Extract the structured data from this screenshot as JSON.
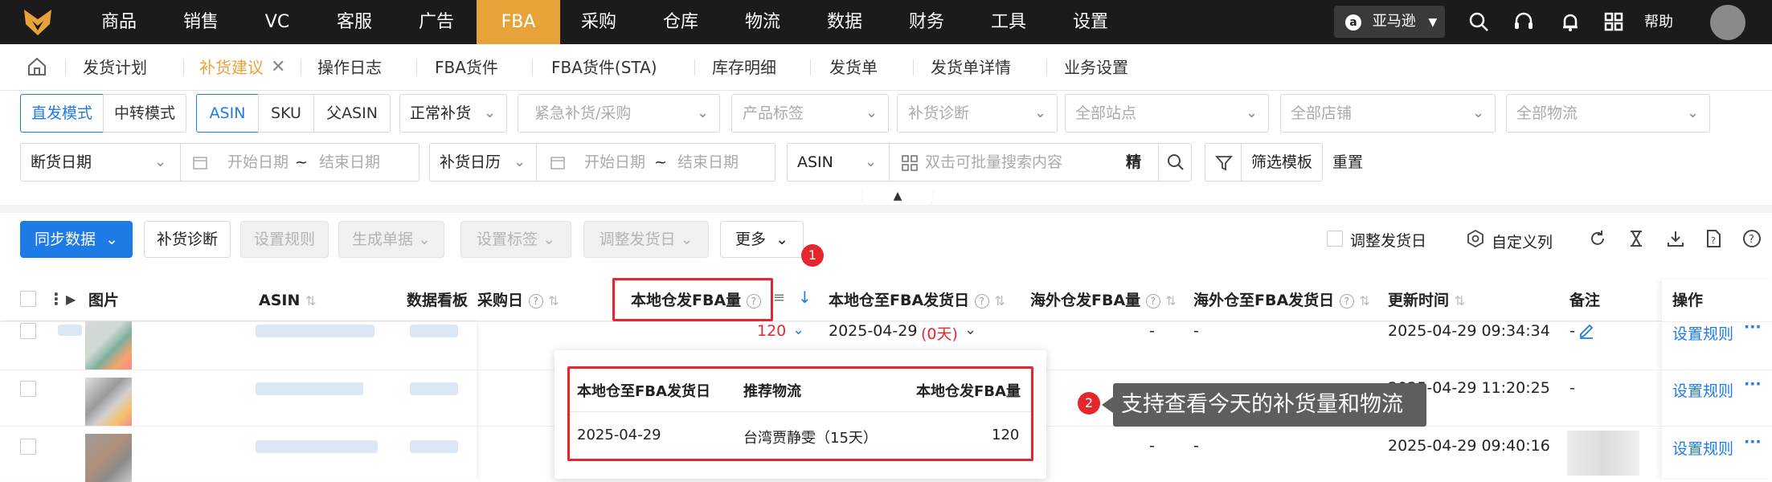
{
  "topnav": {
    "items": [
      "商品",
      "销售",
      "VC",
      "客服",
      "广告",
      "FBA",
      "采购",
      "仓库",
      "物流",
      "数据",
      "财务",
      "工具",
      "设置"
    ],
    "active": "FBA",
    "marketplace": "亚马逊",
    "help": "帮助"
  },
  "tabs": [
    "发货计划",
    "补货建议",
    "操作日志",
    "FBA货件",
    "FBA货件(STA)",
    "库存明细",
    "发货单",
    "发货单详情",
    "业务设置"
  ],
  "active_tab": "补货建议",
  "filters": {
    "mode": [
      "直发模式",
      "中转模式"
    ],
    "id_type": [
      "ASIN",
      "SKU",
      "父ASIN"
    ],
    "replenish_type": "正常补货",
    "urgent_ph": "紧急补货/采购",
    "tag_ph": "产品标签",
    "diag_ph": "补货诊断",
    "site_ph": "全部站点",
    "shop_ph": "全部店铺",
    "logistics_ph": "全部物流",
    "date_type1": "断货日期",
    "start_ph": "开始日期",
    "tilde": "~",
    "end_ph": "结束日期",
    "date_type2": "补货日历",
    "search_field": "ASIN",
    "search_ph": "双击可批量搜索内容",
    "exact": "精",
    "template": "筛选模板",
    "reset": "重置"
  },
  "toolbar": {
    "sync": "同步数据",
    "diagnose": "补货诊断",
    "rules": "设置规则",
    "generate": "生成单据",
    "set_tag": "设置标签",
    "adjust_date": "调整发货日",
    "more": "更多",
    "adjust_ship_day": "调整发货日",
    "custom_cols": "自定义列"
  },
  "columns": {
    "image": "图片",
    "asin": "ASIN",
    "board": "数据看板",
    "purchase_day": "采购日",
    "local_qty": "本地仓发FBA量",
    "local_ship_day": "本地仓至FBA发货日",
    "overseas_qty": "海外仓发FBA量",
    "overseas_ship_day": "海外仓至FBA发货日",
    "updated": "更新时间",
    "remark": "备注",
    "action": "操作"
  },
  "rows": [
    {
      "local_qty": "120",
      "ship_day": "2025-04-29",
      "ship_note": "(0天)",
      "overseas_qty": "-",
      "overseas_day": "-",
      "updated": "2025-04-29 09:34:34",
      "remark": "-",
      "action": "设置规则"
    },
    {
      "local_qty": "",
      "ship_day": "",
      "ship_note": "",
      "overseas_qty": "",
      "overseas_day": "",
      "updated": "2025-04-29 11:20:25",
      "remark": "-",
      "action": "设置规则"
    },
    {
      "local_qty": "",
      "ship_day": "",
      "ship_note": "",
      "overseas_qty": "-",
      "overseas_day": "-",
      "updated": "2025-04-29 09:40:16",
      "remark": "",
      "action": "设置规则"
    }
  ],
  "popup": {
    "headers": [
      "本地仓至FBA发货日",
      "推荐物流",
      "本地仓发FBA量"
    ],
    "row": {
      "date": "2025-04-29",
      "logistics": "台湾贾静雯（15天）",
      "qty": "120"
    }
  },
  "annotations": {
    "badge1": "1",
    "badge2": "2",
    "tooltip": "支持查看今天的补货量和物流"
  },
  "colors": {
    "brand": "#e8a23a",
    "primary": "#1e7be6",
    "highlight": "#e6262e"
  }
}
